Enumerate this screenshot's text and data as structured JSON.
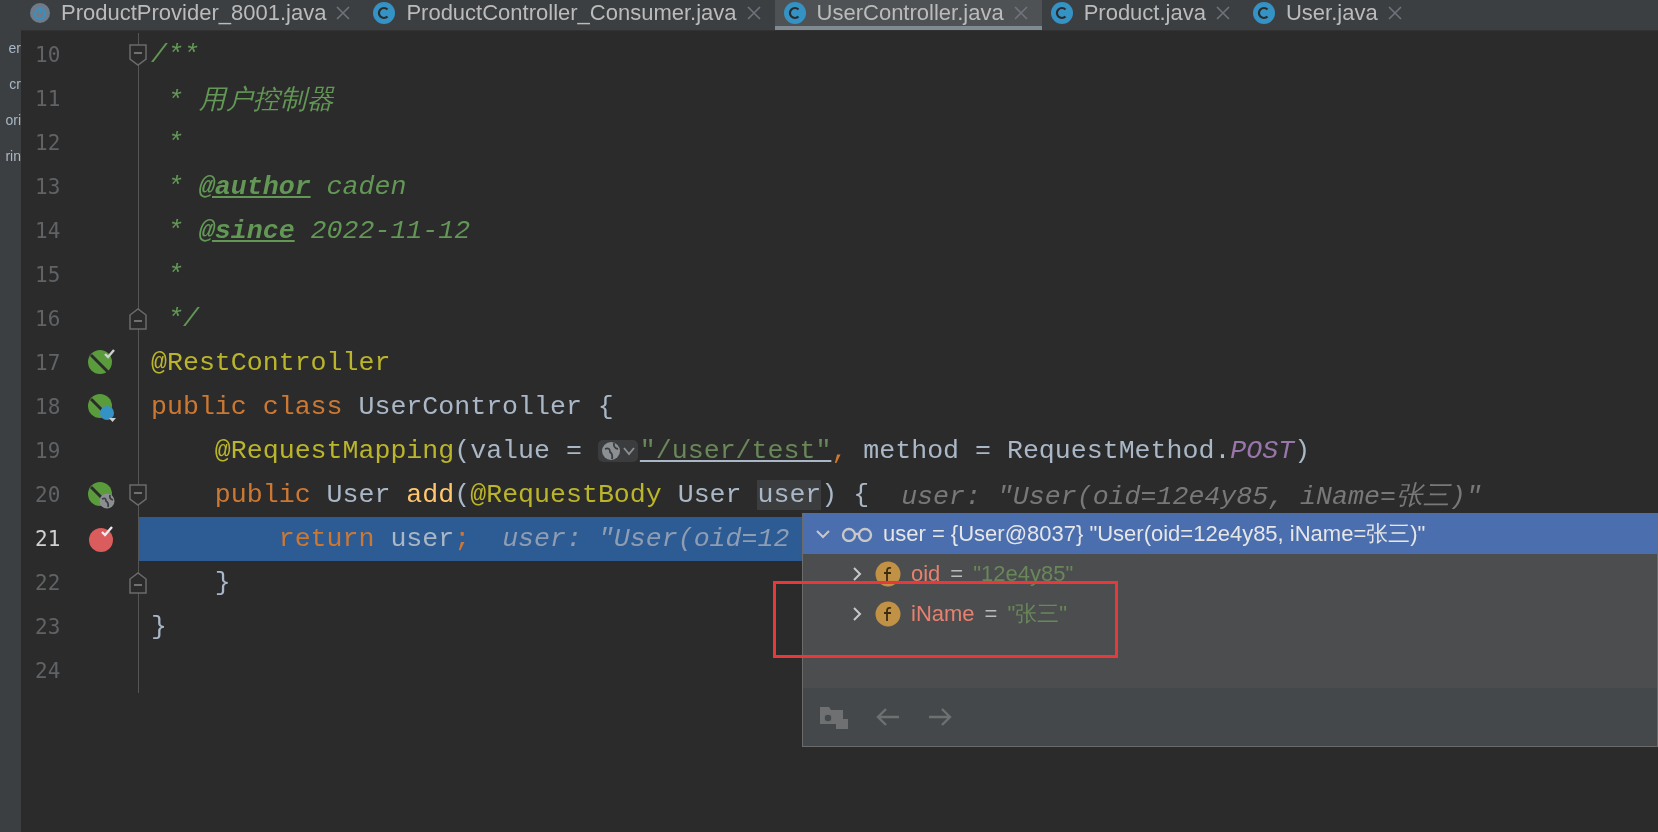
{
  "side_panel": {
    "fragments": [
      "er",
      "cr",
      "ori",
      "rin"
    ]
  },
  "tabs": [
    {
      "label": "ProductProvider_8001.java",
      "kind": "app",
      "selected": false
    },
    {
      "label": "ProductController_Consumer.java",
      "kind": "class",
      "selected": false
    },
    {
      "label": "UserController.java",
      "kind": "class",
      "selected": true
    },
    {
      "label": "Product.java",
      "kind": "class",
      "selected": false
    },
    {
      "label": "User.java",
      "kind": "class",
      "selected": false
    }
  ],
  "editor": {
    "lines": [
      {
        "number": "10",
        "fold": {
          "kind": "start"
        },
        "current": false,
        "tokens": [
          {
            "kind": "comment",
            "text": "/**"
          }
        ]
      },
      {
        "number": "11",
        "current": false,
        "tokens": [
          {
            "kind": "comment",
            "text": " * 用户控制器"
          }
        ]
      },
      {
        "number": "12",
        "current": false,
        "tokens": [
          {
            "kind": "comment",
            "text": " *"
          }
        ]
      },
      {
        "number": "13",
        "current": false,
        "tokens": [
          {
            "kind": "comment",
            "text": " * "
          },
          {
            "kind": "doctag",
            "text": "@author"
          },
          {
            "kind": "comment",
            "text": " caden"
          }
        ]
      },
      {
        "number": "14",
        "current": false,
        "tokens": [
          {
            "kind": "comment",
            "text": " * "
          },
          {
            "kind": "doctag",
            "text": "@since"
          },
          {
            "kind": "comment",
            "text": " 2022-11-12"
          }
        ]
      },
      {
        "number": "15",
        "current": false,
        "tokens": [
          {
            "kind": "comment",
            "text": " *"
          }
        ]
      },
      {
        "number": "16",
        "fold": {
          "kind": "end"
        },
        "current": false,
        "tokens": [
          {
            "kind": "comment",
            "text": " */"
          }
        ]
      },
      {
        "number": "17",
        "gutter_icon": {
          "kind": "bean-check"
        },
        "current": false,
        "tokens": [
          {
            "kind": "annotation",
            "text": "@RestController"
          }
        ]
      },
      {
        "number": "18",
        "gutter_icon": {
          "kind": "bean-class"
        },
        "current": false,
        "tokens": [
          {
            "kind": "keyword",
            "text": "public class "
          },
          {
            "kind": "plain",
            "text": "UserController {"
          }
        ]
      },
      {
        "number": "19",
        "current": false,
        "tokens": [
          {
            "kind": "annotation",
            "text": "    @RequestMapping"
          },
          {
            "kind": "plain",
            "text": "(value = "
          },
          {
            "kind": "widget"
          },
          {
            "kind": "url",
            "text": "\"/user/test\""
          },
          {
            "kind": "keyword",
            "text": ", "
          },
          {
            "kind": "plain",
            "text": "method = RequestMethod."
          },
          {
            "kind": "static",
            "text": "POST"
          },
          {
            "kind": "plain",
            "text": ")"
          }
        ]
      },
      {
        "number": "20",
        "fold": {
          "kind": "start"
        },
        "gutter_icon": {
          "kind": "bean-globe"
        },
        "current": false,
        "tokens": [
          {
            "kind": "keyword",
            "text": "    public "
          },
          {
            "kind": "plain",
            "text": "User "
          },
          {
            "kind": "method",
            "text": "add"
          },
          {
            "kind": "plain",
            "text": "("
          },
          {
            "kind": "annotation",
            "text": "@RequestBody "
          },
          {
            "kind": "plain",
            "text": "User "
          },
          {
            "kind": "ident_highlight",
            "text": "user"
          },
          {
            "kind": "plain",
            "text": ") {  "
          },
          {
            "kind": "hint",
            "text": "user: \"User(oid=12e4y85, iName=张三)\""
          }
        ]
      },
      {
        "number": "21",
        "gutter_icon": {
          "kind": "breakpoint"
        },
        "current": true,
        "tokens": [
          {
            "kind": "keyword",
            "text": "        return "
          },
          {
            "kind": "plain",
            "text": "user"
          },
          {
            "kind": "keyword",
            "text": ";  "
          },
          {
            "kind": "hint",
            "text": "user: \"User(oid=12"
          }
        ]
      },
      {
        "number": "22",
        "fold": {
          "kind": "end"
        },
        "current": false,
        "tokens": [
          {
            "kind": "plain",
            "text": "    }"
          }
        ]
      },
      {
        "number": "23",
        "current": false,
        "tokens": [
          {
            "kind": "plain",
            "text": "}"
          }
        ]
      },
      {
        "number": "24",
        "current": false
      }
    ]
  },
  "debug_popup": {
    "header": {
      "expanded": true,
      "text": "user = {User@8037} \"User(oid=12e4y85, iName=张三)\""
    },
    "fields": [
      {
        "name": "oid",
        "separator": "=",
        "value": "\"12e4y85\"",
        "expanded": false
      },
      {
        "name": "iName",
        "separator": "=",
        "value": "\"张三\"",
        "expanded": false
      }
    ],
    "toolbar": [
      {
        "kind": "inspect",
        "disabled": true
      },
      {
        "kind": "back",
        "disabled": true
      },
      {
        "kind": "forward",
        "disabled": true
      }
    ]
  }
}
